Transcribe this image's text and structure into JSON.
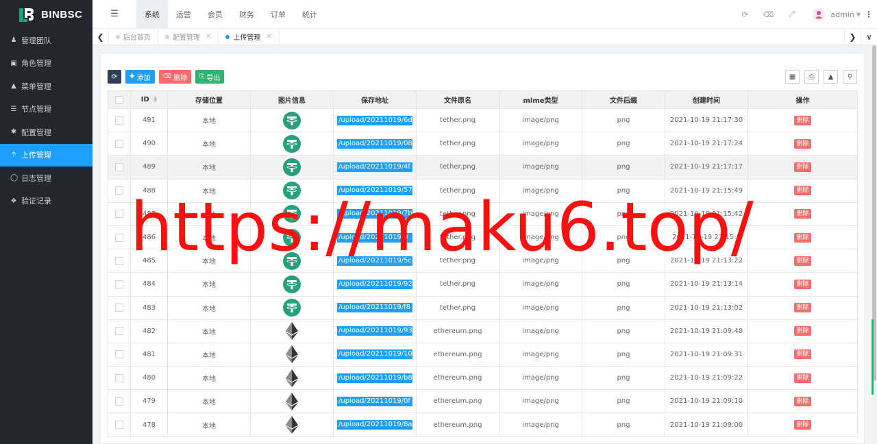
{
  "brand": {
    "name": "BINBSC"
  },
  "sidebar": {
    "items": [
      {
        "label": "管理团队",
        "icon": "user-icon"
      },
      {
        "label": "角色管理",
        "icon": "id-card-icon"
      },
      {
        "label": "菜单管理",
        "icon": "tree-icon"
      },
      {
        "label": "节点管理",
        "icon": "list-icon"
      },
      {
        "label": "配置管理",
        "icon": "gear-icon"
      },
      {
        "label": "上传管理",
        "icon": "upload-icon",
        "active": true
      },
      {
        "label": "日志管理",
        "icon": "log-icon"
      },
      {
        "label": "验证记录",
        "icon": "shield-icon"
      }
    ]
  },
  "topnav": {
    "items": [
      "系统",
      "运营",
      "会员",
      "财务",
      "订单",
      "统计"
    ],
    "active": "系统"
  },
  "user": {
    "name": "admin"
  },
  "tabs": [
    {
      "label": "后台首页",
      "closable": false
    },
    {
      "label": "配置管理",
      "closable": true
    },
    {
      "label": "上传管理",
      "closable": true,
      "active": true
    }
  ],
  "toolbar": {
    "add_label": "添加",
    "delete_label": "删除",
    "export_label": "导出"
  },
  "table": {
    "columns": [
      "ID",
      "存储位置",
      "图片信息",
      "保存地址",
      "文件原名",
      "mime类型",
      "文件后缀",
      "创建时间",
      "操作"
    ],
    "rows": [
      {
        "id": "491",
        "storage": "本地",
        "image": "tether",
        "path": "/upload/20211019/6d",
        "name": "tether.png",
        "mime": "image/png",
        "ext": "png",
        "time": "2021-10-19 21:17:30",
        "action": "删除"
      },
      {
        "id": "490",
        "storage": "本地",
        "image": "tether",
        "path": "/upload/20211019/08",
        "name": "tether.png",
        "mime": "image/png",
        "ext": "png",
        "time": "2021-10-19 21:17:24",
        "action": "删除"
      },
      {
        "id": "489",
        "storage": "本地",
        "image": "tether",
        "path": "/upload/20211019/4f",
        "name": "tether.png",
        "mime": "image/png",
        "ext": "png",
        "time": "2021-10-19 21:17:17",
        "action": "删除"
      },
      {
        "id": "488",
        "storage": "本地",
        "image": "tether",
        "path": "/upload/20211019/57",
        "name": "tether.png",
        "mime": "image/png",
        "ext": "png",
        "time": "2021-10-19 21:15:49",
        "action": "删除"
      },
      {
        "id": "487",
        "storage": "本地",
        "image": "tether",
        "path": "/upload/20211019/7b",
        "name": "tether.png",
        "mime": "image/png",
        "ext": "png",
        "time": "2021-10-19 21:15:42",
        "action": "删除"
      },
      {
        "id": "486",
        "storage": "本地",
        "image": "tether",
        "path": "/upload/20211019/8",
        "name": "tether.png",
        "mime": "image/png",
        "ext": "png",
        "time": "2021-10-19 21:15:3",
        "action": "删除"
      },
      {
        "id": "485",
        "storage": "本地",
        "image": "tether",
        "path": "/upload/20211019/5c",
        "name": "tether.png",
        "mime": "image/png",
        "ext": "png",
        "time": "2021-10-19 21:13:22",
        "action": "删除"
      },
      {
        "id": "484",
        "storage": "本地",
        "image": "tether",
        "path": "/upload/20211019/92",
        "name": "tether.png",
        "mime": "image/png",
        "ext": "png",
        "time": "2021-10-19 21:13:14",
        "action": "删除"
      },
      {
        "id": "483",
        "storage": "本地",
        "image": "tether",
        "path": "/upload/20211019/f8",
        "name": "tether.png",
        "mime": "image/png",
        "ext": "png",
        "time": "2021-10-19 21:13:02",
        "action": "删除"
      },
      {
        "id": "482",
        "storage": "本地",
        "image": "ethereum",
        "path": "/upload/20211019/93",
        "name": "ethereum.png",
        "mime": "image/png",
        "ext": "png",
        "time": "2021-10-19 21:09:40",
        "action": "删除"
      },
      {
        "id": "481",
        "storage": "本地",
        "image": "ethereum",
        "path": "/upload/20211019/10",
        "name": "ethereum.png",
        "mime": "image/png",
        "ext": "png",
        "time": "2021-10-19 21:09:31",
        "action": "删除"
      },
      {
        "id": "480",
        "storage": "本地",
        "image": "ethereum",
        "path": "/upload/20211019/b8",
        "name": "ethereum.png",
        "mime": "image/png",
        "ext": "png",
        "time": "2021-10-19 21:09:22",
        "action": "删除"
      },
      {
        "id": "479",
        "storage": "本地",
        "image": "ethereum",
        "path": "/upload/20211019/0f",
        "name": "ethereum.png",
        "mime": "image/png",
        "ext": "png",
        "time": "2021-10-19 21:09:10",
        "action": "删除"
      },
      {
        "id": "478",
        "storage": "本地",
        "image": "ethereum",
        "path": "/upload/20211019/8a",
        "name": "ethereum.png",
        "mime": "image/png",
        "ext": "png",
        "time": "2021-10-19 21:09:00",
        "action": "删除"
      }
    ]
  },
  "watermark": {
    "text": "https://maku6.top/"
  },
  "colors": {
    "accent": "#1e9fff",
    "sidebar_bg": "#22272e",
    "danger": "#ff6a6a",
    "success": "#2fb36e",
    "tether": "#26a17b",
    "watermark": "#ff1010"
  }
}
